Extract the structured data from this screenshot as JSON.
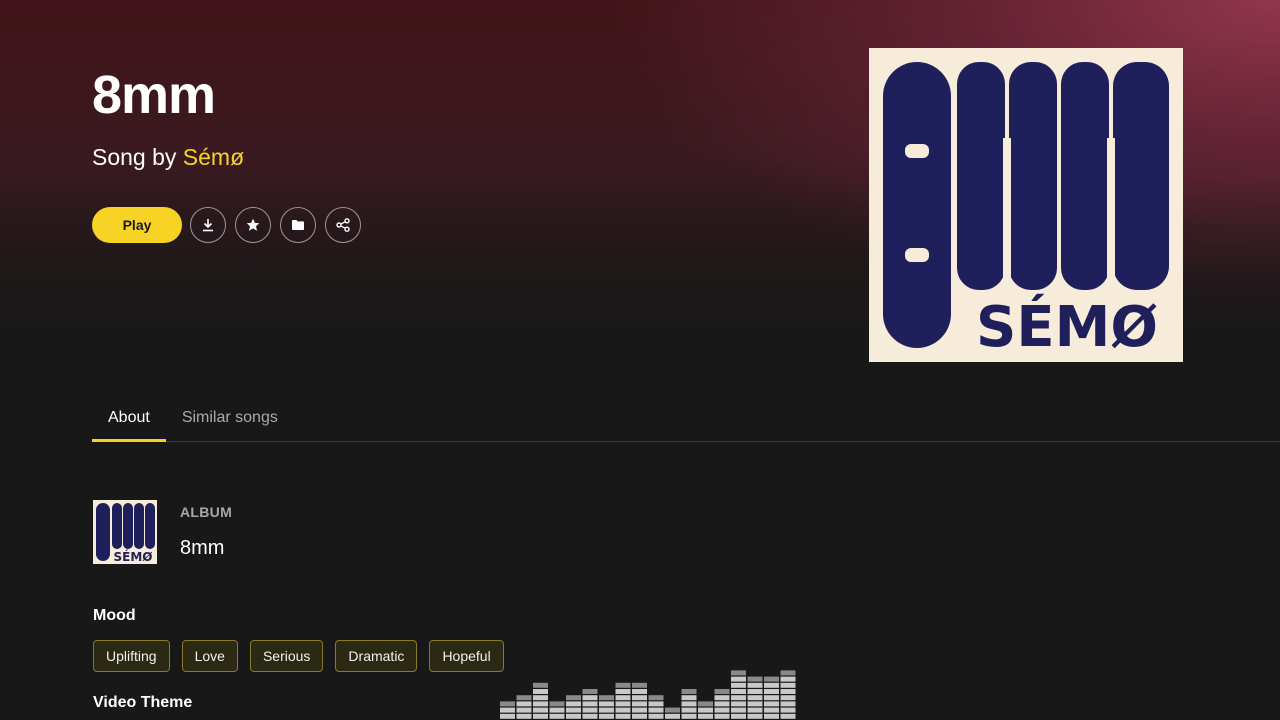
{
  "song": {
    "title": "8mm",
    "subtitle_prefix": "Song by ",
    "artist": "Sémø"
  },
  "actions": {
    "play_label": "Play",
    "icons": [
      "download-icon",
      "star-icon",
      "folder-icon",
      "share-icon"
    ]
  },
  "cover": {
    "art_text_top": "8MM",
    "art_text_bottom": "SÉMØ",
    "bg_color": "#f7ecd9",
    "ink_color": "#1f1f5c"
  },
  "tabs": [
    {
      "label": "About",
      "active": true
    },
    {
      "label": "Similar songs",
      "active": false
    }
  ],
  "album": {
    "label": "ALBUM",
    "name": "8mm"
  },
  "mood": {
    "heading": "Mood",
    "tags": [
      "Uplifting",
      "Love",
      "Serious",
      "Dramatic",
      "Hopeful"
    ]
  },
  "video_theme": {
    "heading": "Video Theme"
  },
  "colors": {
    "accent": "#f7d326",
    "background": "#181818"
  }
}
